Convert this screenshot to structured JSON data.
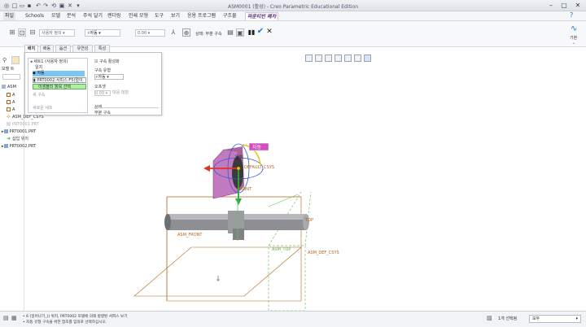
{
  "window": {
    "title": "ASM0001 (활성) - Creo Parametric Educational Edition"
  },
  "menu": {
    "items": [
      "파일",
      "Schools",
      "모델",
      "분석",
      "주석 달기",
      "렌더링",
      "인쇄 모형",
      "도구",
      "보기",
      "응용 프로그램",
      "구조물"
    ],
    "active_tab": "파운티빈 폐차"
  },
  "ribbon": {
    "constraint_type": "사용자 정의",
    "auto_label": "자동",
    "offset_value": "0.00",
    "status_label": "상태: 부분 구속",
    "right_label": "기본"
  },
  "dashboard_tabs": [
    "배치",
    "배동",
    "옵션",
    "유연성",
    "특성"
  ],
  "navigator": {
    "model_tree_label": "모델 트",
    "items": [
      {
        "label": "ASM",
        "gray": false
      },
      {
        "label": "A",
        "gray": false
      },
      {
        "label": "A",
        "gray": false
      },
      {
        "label": "A",
        "gray": false
      },
      {
        "label": "ASM_DEF_CSYS",
        "gray": false
      },
      {
        "label": "PRT0001.PRT",
        "gray": true
      },
      {
        "label": "PRT0001.PRT",
        "gray": false
      },
      {
        "label": "삽입 위치",
        "gray": false
      },
      {
        "label": "PRT0002.PRT",
        "gray": false
      }
    ]
  },
  "placement": {
    "set_header": "세트1 (사용자 정의)",
    "item_match": "일치",
    "item_auto": "자동",
    "item_ref": "PRT0002:서피스:F5(멀이",
    "item_select": "어셈블리 항목 선택",
    "new_constraint": "새 구속",
    "new_set": "새로운 세트",
    "enable_constraint": "구속 활성화",
    "constraint_type_label": "구속 유형",
    "constraint_type_value": "자동",
    "offset_label": "오프셋",
    "offset_value": "0.00",
    "flip_label": "대응 데칭",
    "status_label": "상태",
    "status_value": "부분 구속"
  },
  "viewport": {
    "labels": {
      "auto_tag": "자동",
      "match": "일치",
      "front": "FRONT",
      "def_csys": "DEFAULT_CSYS",
      "asm_front": "ASM_FRONT",
      "asm_top": "ASM_TOP",
      "top": "TOP",
      "asm_def_csys": "ASM_DEF_CSYS"
    }
  },
  "status": {
    "line1": "• 6 (일어나기_)) 위치, PRT0002 모델에 의해 방향된 서피스 보기",
    "line2": "• 자동 유형 구속을 위한 참조를 임의로 선택하십시오.",
    "selection": "1개 선택됨",
    "filter": "모두"
  },
  "colors": {
    "accent": "#1a6fd1",
    "active_tab": "#5a2a8a",
    "highlight_magenta": "#d04fc0",
    "selection_blue": "#7ec4f0",
    "select_green": "#aef0a8",
    "datum_brown": "#b0651a"
  }
}
